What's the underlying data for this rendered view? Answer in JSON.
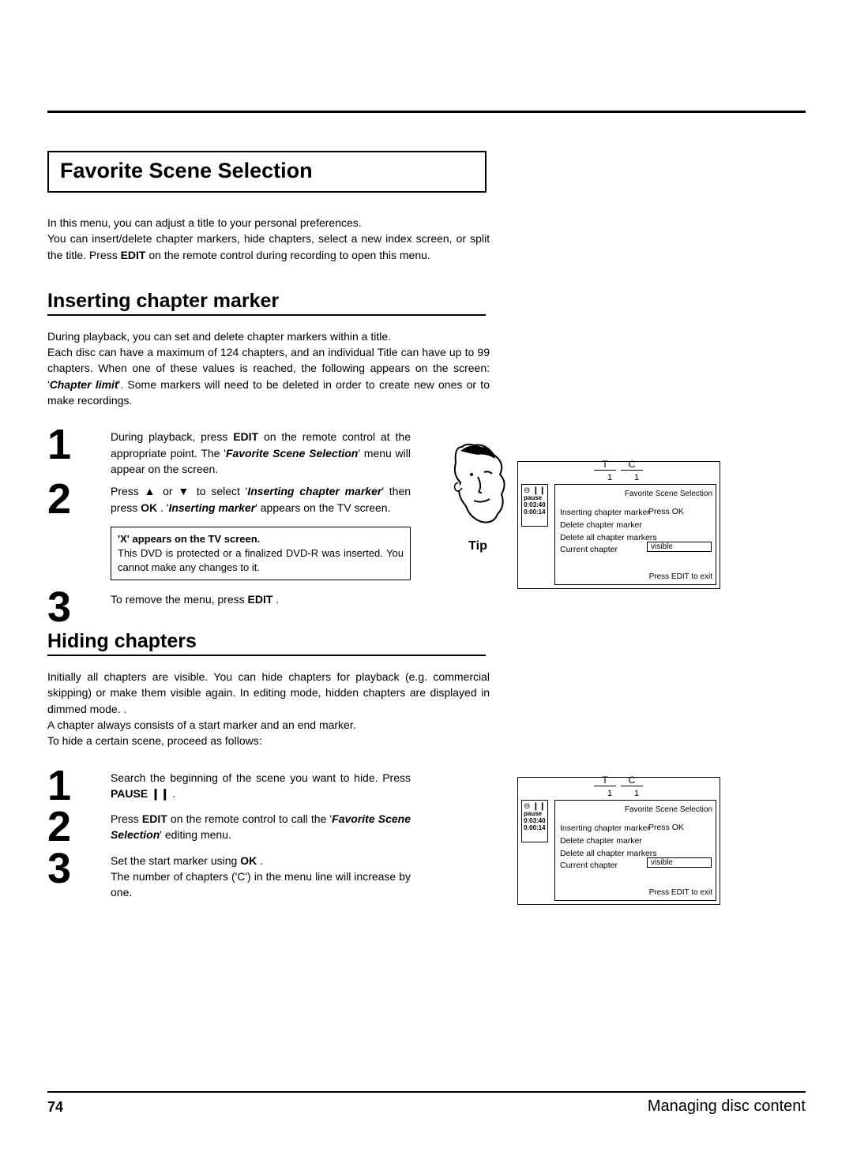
{
  "title_box": "Favorite Scene Selection",
  "intro": {
    "line1": "In this menu, you can adjust a title to your personal preferences.",
    "line2a": "You can insert/delete chapter markers, hide chapters, select a new index screen, or split the title. Press ",
    "edit": "EDIT",
    "line2b": " on the remote control during recording to open this menu."
  },
  "sec1": {
    "heading": "Inserting chapter marker",
    "p1": "During playback, you can set and delete chapter markers within a title.",
    "p2a": "Each disc can have a maximum of 124 chapters, and an individual Title can have up to 99 chapters. When one of these values is reached, the following appears on the screen: '",
    "p2b": "Chapter limit",
    "p2c": "'. Some markers will need to be deleted in order to create new ones or to make recordings.",
    "step1": {
      "n": "1",
      "a": "During playback, press ",
      "edit": "EDIT",
      "b": " on the remote control at the appropriate point. The '",
      "fss": "Favorite Scene Selection",
      "c": "' menu will appear on the screen."
    },
    "step2": {
      "n": "2",
      "a": "Press ",
      "up": "▲",
      "or": " or ",
      "down": "▼",
      "b": " to select '",
      "icm": "Inserting chapter marker",
      "c": "' then press ",
      "ok": "OK",
      "d": " . '",
      "im": "Inserting marker",
      "e": "' appears on the TV screen."
    },
    "note": {
      "title": "'X' appears on the TV screen.",
      "body": "This DVD is protected or a finalized DVD-R was inserted. You cannot make any changes to it."
    },
    "step3": {
      "n": "3",
      "a": "To remove the menu, press ",
      "edit": "EDIT",
      "b": " ."
    },
    "tip": "Tip"
  },
  "sec2": {
    "heading": "Hiding chapters",
    "p1": "Initially all chapters are visible. You can hide chapters for playback (e.g. commercial skipping) or make them visible again. In editing mode, hidden chapters are displayed in dimmed mode. .",
    "p2": "A chapter always consists of a start marker and an end marker.",
    "p3": "To hide a certain scene, proceed as follows:",
    "step1": {
      "n": "1",
      "a": "Search the beginning of the scene you want to hide. Press ",
      "pause": "PAUSE ❙❙ ",
      "b": " ."
    },
    "step2": {
      "n": "2",
      "a": "Press ",
      "edit": "EDIT",
      "b": " on the remote control to call the '",
      "fss": "Favorite Scene Selection",
      "c": "' editing menu."
    },
    "step3": {
      "n": "3",
      "a": "Set the start marker using ",
      "ok": "OK",
      "b": " .",
      "c": "The number of chapters ('C') in the menu line will increase by one."
    }
  },
  "osd": {
    "T": "T",
    "C": "C",
    "one1": "1",
    "one2": "1",
    "side_s": "⊖ ❙❙",
    "side_p": "pause",
    "side_t1": "0:03:40",
    "side_t2": "0:00:14",
    "title": "Favorite Scene Selection",
    "items": [
      "Inserting chapter marker",
      "Delete chapter marker",
      "Delete all chapter markers",
      "Current chapter"
    ],
    "pressok": "Press OK",
    "visible": "visible",
    "footer": "Press EDIT to exit"
  },
  "footer": {
    "page": "74",
    "section": "Managing disc content"
  }
}
